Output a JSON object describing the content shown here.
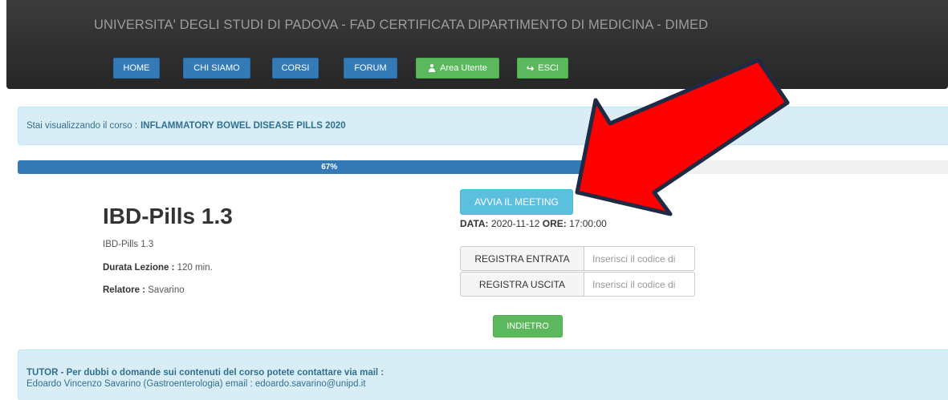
{
  "site": {
    "title": "UNIVERSITA' DEGLI STUDI DI PADOVA - FAD CERTIFICATA DIPARTIMENTO DI MEDICINA - DIMED"
  },
  "nav": {
    "home": "HOME",
    "chi_siamo": "CHI SIAMO",
    "corsi": "CORSI",
    "forum": "FORUM",
    "area_utente": "Area Utente",
    "esci": "ESCI"
  },
  "course_info": {
    "prefix": "Stai visualizzando il corso :",
    "name": "INFLAMMATORY BOWEL DISEASE PILLS 2020"
  },
  "progress": {
    "label": "67%",
    "value": 0.67
  },
  "lesson": {
    "title": "IBD-Pills 1.3",
    "subtitle": "IBD-Pills 1.3",
    "durata_label": "Durata Lezione :",
    "durata_value": "120 min.",
    "relatore_label": "Relatore :",
    "relatore_value": "Savarino"
  },
  "meeting": {
    "button": "AVVIA IL MEETING",
    "data_label": "DATA:",
    "data_value": "2020-11-12",
    "ore_label": "ORE:",
    "ore_value": "17:00:00"
  },
  "register": {
    "entrata_button": "REGISTRA ENTRATA",
    "entrata_placeholder": "Inserisci il codice di",
    "uscita_button": "REGISTRA USCITA",
    "uscita_placeholder": "Inserisci il codice di"
  },
  "back_button": "INDIETRO",
  "tutor": {
    "heading": "TUTOR - Per dubbi o domande sui contenuti del corso potete contattare via mail :",
    "contact": "Edoardo Vincenzo Savarino (Gastroenterologia) email : edoardo.savarino@unipd.it"
  },
  "icons": {
    "user": "user-icon",
    "logout": "sign-out-icon",
    "annotation": "red-arrow"
  },
  "colors": {
    "navbar_bg": "#2e2e2e",
    "primary": "#337ab7",
    "success": "#5cb85c",
    "info": "#5bc0de",
    "alert_bg": "#d9edf7",
    "alert_text": "#31708f",
    "arrow": "#ff0000"
  }
}
